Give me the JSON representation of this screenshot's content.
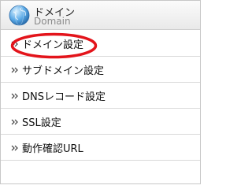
{
  "header": {
    "title": "ドメイン",
    "subtitle": "Domain",
    "icon": "globe-icon"
  },
  "menu": {
    "items": [
      {
        "label": "ドメイン設定"
      },
      {
        "label": "サブドメイン設定"
      },
      {
        "label": "DNSレコード設定"
      },
      {
        "label": "SSL設定"
      },
      {
        "label": "動作確認URL"
      }
    ]
  },
  "colors": {
    "highlight": "#e3141b",
    "arrow": "#3a3a3a"
  }
}
